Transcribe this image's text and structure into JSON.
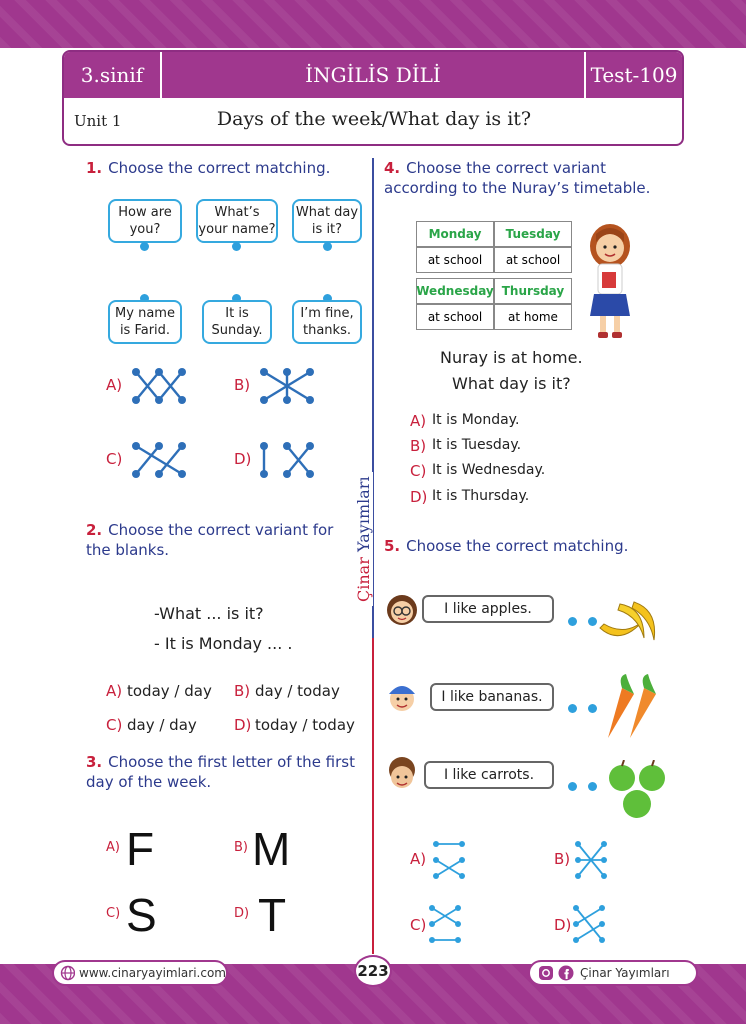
{
  "header": {
    "grade": "3.sinif",
    "subject": "İNGİLİS DİLİ",
    "test": "Test-109",
    "unit": "Unit 1",
    "topic": "Days of the week/What day is it?"
  },
  "q1": {
    "number": "1.",
    "prompt": "Choose the correct matching.",
    "top_bubbles": [
      "How are you?",
      "What’s your name?",
      "What day is it?"
    ],
    "bottom_bubbles": [
      "My name is Farid.",
      "It is Sunday.",
      "I’m fine, thanks."
    ],
    "options": [
      "A)",
      "B)",
      "C)",
      "D)"
    ]
  },
  "q2": {
    "number": "2.",
    "prompt": "Choose the correct variant for the blanks.",
    "line1": "-What ... is it?",
    "line2": "- It is Monday ... .",
    "options": [
      {
        "label": "A)",
        "text": "today / day"
      },
      {
        "label": "B)",
        "text": "day / today"
      },
      {
        "label": "C)",
        "text": "day / day"
      },
      {
        "label": "D)",
        "text": "today / today"
      }
    ]
  },
  "q3": {
    "number": "3.",
    "prompt": "Choose the first letter of the first day of the week.",
    "options": [
      {
        "label": "A)",
        "text": "F"
      },
      {
        "label": "B)",
        "text": "M"
      },
      {
        "label": "C)",
        "text": "S"
      },
      {
        "label": "D)",
        "text": "T"
      }
    ]
  },
  "q4": {
    "number": "4.",
    "prompt": "Choose the correct variant according to the Nuray’s timetable.",
    "timetable": {
      "days1": [
        "Monday",
        "Tuesday"
      ],
      "values1": [
        "at school",
        "at school"
      ],
      "days2": [
        "Wednesday",
        "Thursday"
      ],
      "values2": [
        "at school",
        "at home"
      ]
    },
    "statement": "Nuray is at home.",
    "question": "What day is it?",
    "options": [
      {
        "label": "A)",
        "text": "It is Monday."
      },
      {
        "label": "B)",
        "text": "It is Tuesday."
      },
      {
        "label": "C)",
        "text": "It is Wednesday."
      },
      {
        "label": "D)",
        "text": "It is Thursday."
      }
    ]
  },
  "q5": {
    "number": "5.",
    "prompt": "Choose the correct matching.",
    "sentences": [
      "I like apples.",
      "I like bananas.",
      "I like carrots."
    ],
    "options": [
      "A)",
      "B)",
      "C)",
      "D)"
    ]
  },
  "brand_side": {
    "part1": "Çinar",
    "part2": "Yayımları"
  },
  "footer": {
    "website": "www.cinaryayimlari.com",
    "page": "223",
    "social": "Çinar Yayımları"
  },
  "colors": {
    "brand": "#a0378e",
    "question_text": "#2c3a8c",
    "accent_red": "#c8203c",
    "dot_blue": "#2ea0dd",
    "day_green": "#2aa548"
  }
}
